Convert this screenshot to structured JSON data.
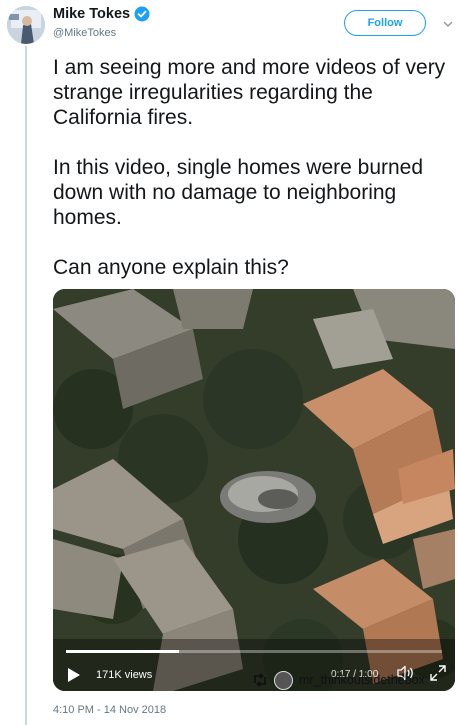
{
  "author": {
    "name": "Mike Tokes",
    "handle": "@MikeTokes",
    "verified": true
  },
  "follow_label": "Follow",
  "tweet": {
    "text": "I am seeing more and more videos of very strange irregularities regarding the California fires.\n\nIn this video, single homes were burned down with no damage to neighboring homes.\n\nCan anyone explain this?"
  },
  "video": {
    "views": "171K views",
    "time": "0:17 / 1:00",
    "progress": 0.3,
    "watermark_user": "mr_thinkoutsidethebox"
  },
  "timestamp": "4:10 PM - 14 Nov 2018",
  "colors": {
    "accent": "#1da1f2",
    "text": "#14171a",
    "secondary": "#657786",
    "thread_line": "#ccd6dd"
  },
  "icons": [
    "verified-badge-icon",
    "chevron-down-icon",
    "play-icon",
    "volume-icon",
    "fullscreen-icon",
    "repost-icon"
  ]
}
